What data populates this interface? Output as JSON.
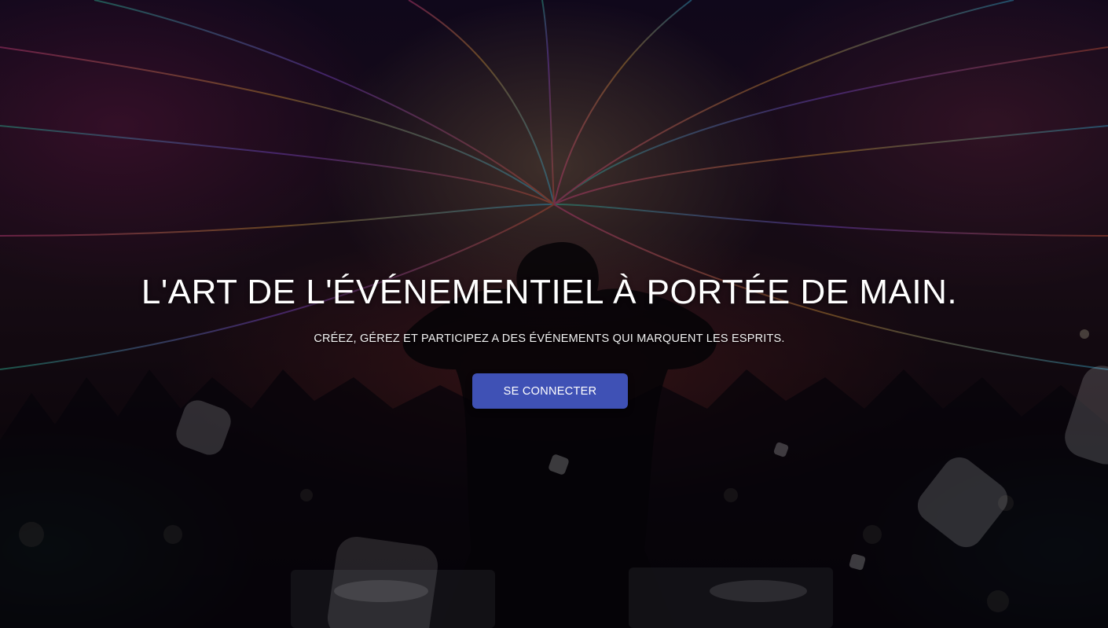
{
  "hero": {
    "title": "L'ART DE L'ÉVÉNEMENTIEL À PORTÉE DE MAIN.",
    "subtitle": "CRÉEZ, GÉREZ ET PARTICIPEZ A DES ÉVÉNEMENTS QUI MARQUENT LES ESPRITS.",
    "cta_label": "SE CONNECTER"
  },
  "colors": {
    "cta_background": "#3f51b5",
    "text": "#ffffff"
  },
  "background": {
    "image": "dj-concert-neon-light-streams"
  }
}
